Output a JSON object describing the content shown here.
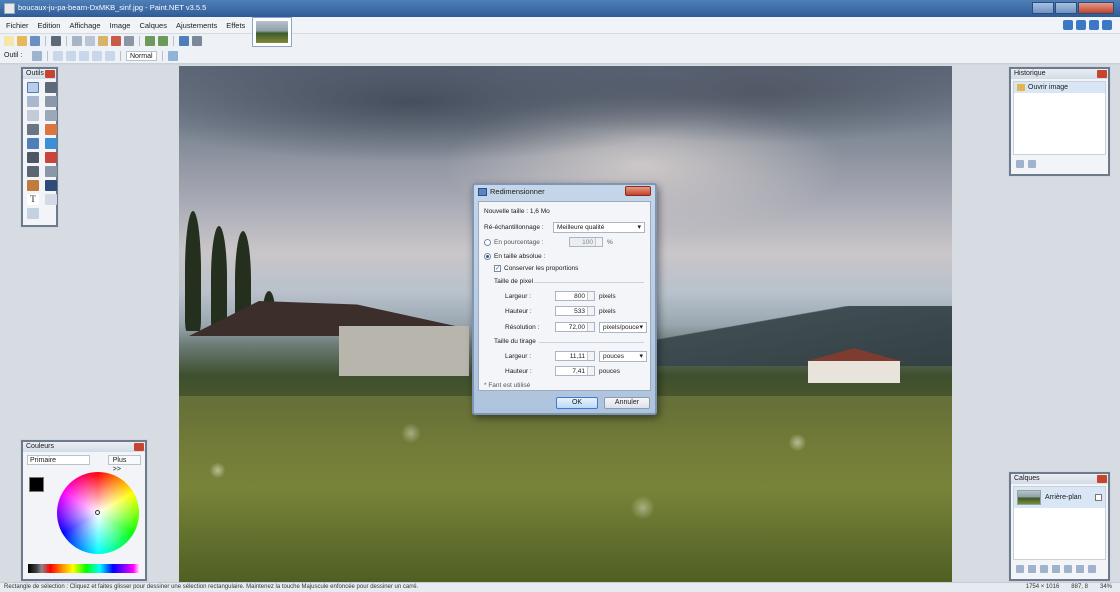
{
  "window": {
    "title": "boucaux-ju-pa-bearn-DxMKB_sinf.jpg - Paint.NET v3.5.5"
  },
  "menu": {
    "items": [
      "Fichier",
      "Edition",
      "Affichage",
      "Image",
      "Calques",
      "Ajustements",
      "Effets"
    ]
  },
  "toolbar": {
    "tool_label": "Outil :",
    "blend_mode": "Normal"
  },
  "panels": {
    "tools": {
      "title": "Outils"
    },
    "history": {
      "title": "Historique",
      "item": "Ouvrir image"
    },
    "colors": {
      "title": "Couleurs",
      "mode": "Primaire",
      "more_button": "Plus >>"
    },
    "layers": {
      "title": "Calques",
      "layer_name": "Arrière-plan"
    }
  },
  "dialog": {
    "title": "Redimensionner",
    "new_size": "Nouvelle taille : 1,6 Mo",
    "resampling_label": "Ré-échantillonnage :",
    "resampling_value": "Meilleure qualité",
    "by_percent_label": "En pourcentage :",
    "percent_value": "100",
    "percent_unit": "%",
    "absolute_label": "En taille absolue :",
    "keep_ratio_label": "Conserver les proportions",
    "pixel_size_group": "Taille de pixel",
    "width_label": "Largeur :",
    "width_value": "800",
    "width_unit": "pixels",
    "height_label": "Hauteur :",
    "height_value": "533",
    "height_unit": "pixels",
    "resolution_label": "Résolution :",
    "resolution_value": "72,00",
    "resolution_unit": "pixels/pouce",
    "print_size_group": "Taille du tirage",
    "print_width_label": "Largeur :",
    "print_width_value": "11,11",
    "print_width_unit": "pouces",
    "print_height_label": "Hauteur :",
    "print_height_value": "7,41",
    "print_height_unit": "pouces",
    "footnote": "* Fant est utilisé",
    "ok_button": "OK",
    "cancel_button": "Annuler"
  },
  "status": {
    "text": "Rectangle de sélection : Cliquez et faites glisser pour dessiner une sélection rectangulaire. Maintenez la touche Majuscule enfoncée pour dessiner un carré.",
    "image_size": "1754 × 1016",
    "cursor": "887, 8",
    "zoom": "34%"
  },
  "colors": {
    "titlebar": "#3c6aa6",
    "workspace": "#d7dce2",
    "close_red": "#c2432a"
  }
}
